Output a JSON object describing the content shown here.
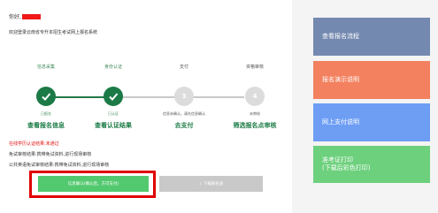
{
  "greeting": {
    "prefix": "你好,"
  },
  "welcome_text": "欢迎登录云南省专升本招生考试网上报名系统",
  "steps": [
    {
      "top": "信息采集",
      "sub": "已报名",
      "link": "查看报名信息",
      "status": "done"
    },
    {
      "top": "身份认证",
      "sub": "已认证",
      "link": "查看认证结果",
      "status": "done"
    },
    {
      "top": "支付",
      "sub": "信息未确认，请先信息确认",
      "link": "去支付",
      "status": "todo",
      "number": "3"
    },
    {
      "top": "资格审核",
      "sub": "未审核",
      "link": "筛选报名点审核",
      "status": "todo",
      "number": "4"
    }
  ],
  "notices": {
    "red": "在线学历认证结果:未通过",
    "line1": "免试审核结果:携带免试资料,进行现场审核",
    "line2": "公共英语免试审核结果:携带免试资料,进行现场审核"
  },
  "buttons": {
    "verify": "信息确认(确认后，方可支付)",
    "download": "⊥ 下载报名表"
  },
  "side_cards": [
    {
      "label": "查看报名流程"
    },
    {
      "label": "报名演示说明"
    },
    {
      "label": "网上支付说明"
    },
    {
      "label": "准考证打印",
      "sub": "(下载后彩色打印)"
    }
  ],
  "colors": {
    "done_green": "#1b7a46",
    "button_green": "#53c96f",
    "highlight_red": "#e00000"
  }
}
